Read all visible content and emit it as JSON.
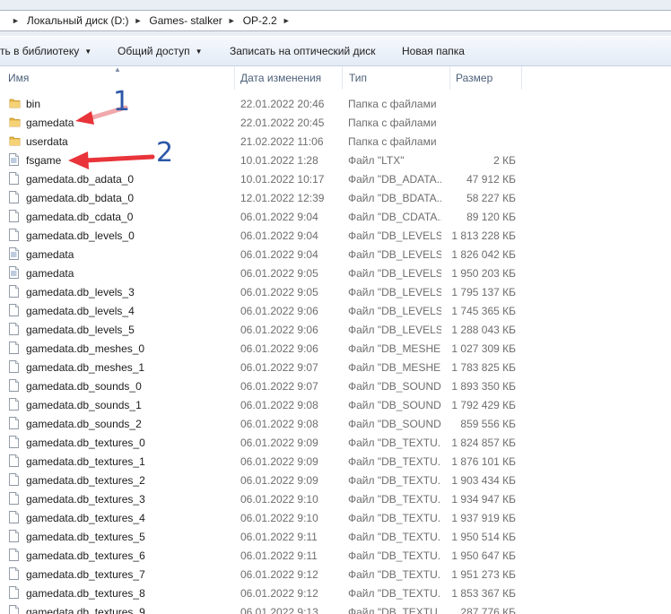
{
  "address": {
    "crumbs": [
      "Локальный диск (D:)",
      "Games- stalker",
      "OP-2.2"
    ]
  },
  "toolbar": {
    "library_label": "ть в библиотеку",
    "share_label": "Общий доступ",
    "burn_label": "Записать на оптический диск",
    "new_folder_label": "Новая папка"
  },
  "columns": {
    "name": "Имя",
    "date": "Дата изменения",
    "type": "Тип",
    "size": "Размер"
  },
  "annotations": {
    "first": "1",
    "second": "2"
  },
  "files": [
    {
      "name": "bin",
      "date": "22.01.2022 20:46",
      "type": "Папка с файлами",
      "size": "",
      "icon": "folder-icon"
    },
    {
      "name": "gamedata",
      "date": "22.01.2022 20:45",
      "type": "Папка с файлами",
      "size": "",
      "icon": "folder-icon"
    },
    {
      "name": "userdata",
      "date": "21.02.2022 11:06",
      "type": "Папка с файлами",
      "size": "",
      "icon": "folder-icon"
    },
    {
      "name": "fsgame",
      "date": "10.01.2022 1:28",
      "type": "Файл \"LTX\"",
      "size": "2 КБ",
      "icon": "text-file-icon"
    },
    {
      "name": "gamedata.db_adata_0",
      "date": "10.01.2022 10:17",
      "type": "Файл \"DB_ADATA...",
      "size": "47 912 КБ",
      "icon": "file-icon"
    },
    {
      "name": "gamedata.db_bdata_0",
      "date": "12.01.2022 12:39",
      "type": "Файл \"DB_BDATA...",
      "size": "58 227 КБ",
      "icon": "file-icon"
    },
    {
      "name": "gamedata.db_cdata_0",
      "date": "06.01.2022 9:04",
      "type": "Файл \"DB_CDATA...",
      "size": "89 120 КБ",
      "icon": "file-icon"
    },
    {
      "name": "gamedata.db_levels_0",
      "date": "06.01.2022 9:04",
      "type": "Файл \"DB_LEVELS...",
      "size": "1 813 228 КБ",
      "icon": "file-icon"
    },
    {
      "name": "gamedata",
      "date": "06.01.2022 9:04",
      "type": "Файл \"DB_LEVELS...",
      "size": "1 826 042 КБ",
      "icon": "text-file-icon"
    },
    {
      "name": "gamedata",
      "date": "06.01.2022 9:05",
      "type": "Файл \"DB_LEVELS...",
      "size": "1 950 203 КБ",
      "icon": "text-file-icon"
    },
    {
      "name": "gamedata.db_levels_3",
      "date": "06.01.2022 9:05",
      "type": "Файл \"DB_LEVELS...",
      "size": "1 795 137 КБ",
      "icon": "file-icon"
    },
    {
      "name": "gamedata.db_levels_4",
      "date": "06.01.2022 9:06",
      "type": "Файл \"DB_LEVELS...",
      "size": "1 745 365 КБ",
      "icon": "file-icon"
    },
    {
      "name": "gamedata.db_levels_5",
      "date": "06.01.2022 9:06",
      "type": "Файл \"DB_LEVELS...",
      "size": "1 288 043 КБ",
      "icon": "file-icon"
    },
    {
      "name": "gamedata.db_meshes_0",
      "date": "06.01.2022 9:06",
      "type": "Файл \"DB_MESHE...",
      "size": "1 027 309 КБ",
      "icon": "file-icon"
    },
    {
      "name": "gamedata.db_meshes_1",
      "date": "06.01.2022 9:07",
      "type": "Файл \"DB_MESHE...",
      "size": "1 783 825 КБ",
      "icon": "file-icon"
    },
    {
      "name": "gamedata.db_sounds_0",
      "date": "06.01.2022 9:07",
      "type": "Файл \"DB_SOUND...",
      "size": "1 893 350 КБ",
      "icon": "file-icon"
    },
    {
      "name": "gamedata.db_sounds_1",
      "date": "06.01.2022 9:08",
      "type": "Файл \"DB_SOUND...",
      "size": "1 792 429 КБ",
      "icon": "file-icon"
    },
    {
      "name": "gamedata.db_sounds_2",
      "date": "06.01.2022 9:08",
      "type": "Файл \"DB_SOUND...",
      "size": "859 556 КБ",
      "icon": "file-icon"
    },
    {
      "name": "gamedata.db_textures_0",
      "date": "06.01.2022 9:09",
      "type": "Файл \"DB_TEXTU...",
      "size": "1 824 857 КБ",
      "icon": "file-icon"
    },
    {
      "name": "gamedata.db_textures_1",
      "date": "06.01.2022 9:09",
      "type": "Файл \"DB_TEXTU...",
      "size": "1 876 101 КБ",
      "icon": "file-icon"
    },
    {
      "name": "gamedata.db_textures_2",
      "date": "06.01.2022 9:09",
      "type": "Файл \"DB_TEXTU...",
      "size": "1 903 434 КБ",
      "icon": "file-icon"
    },
    {
      "name": "gamedata.db_textures_3",
      "date": "06.01.2022 9:10",
      "type": "Файл \"DB_TEXTU...",
      "size": "1 934 947 КБ",
      "icon": "file-icon"
    },
    {
      "name": "gamedata.db_textures_4",
      "date": "06.01.2022 9:10",
      "type": "Файл \"DB_TEXTU...",
      "size": "1 937 919 КБ",
      "icon": "file-icon"
    },
    {
      "name": "gamedata.db_textures_5",
      "date": "06.01.2022 9:11",
      "type": "Файл \"DB_TEXTU...",
      "size": "1 950 514 КБ",
      "icon": "file-icon"
    },
    {
      "name": "gamedata.db_textures_6",
      "date": "06.01.2022 9:11",
      "type": "Файл \"DB_TEXTU...",
      "size": "1 950 647 КБ",
      "icon": "file-icon"
    },
    {
      "name": "gamedata.db_textures_7",
      "date": "06.01.2022 9:12",
      "type": "Файл \"DB_TEXTU...",
      "size": "1 951 273 КБ",
      "icon": "file-icon"
    },
    {
      "name": "gamedata.db_textures_8",
      "date": "06.01.2022 9:12",
      "type": "Файл \"DB_TEXTU...",
      "size": "1 853 367 КБ",
      "icon": "file-icon"
    },
    {
      "name": "gamedata.db_textures_9",
      "date": "06.01.2022 9:13",
      "type": "Файл \"DB_TEXTU...",
      "size": "287 776 КБ",
      "icon": "file-icon"
    }
  ],
  "colors": {
    "annotation_arrow": "#e8343a",
    "annotation_number": "#2c57a8",
    "folder": "#e8b844"
  }
}
